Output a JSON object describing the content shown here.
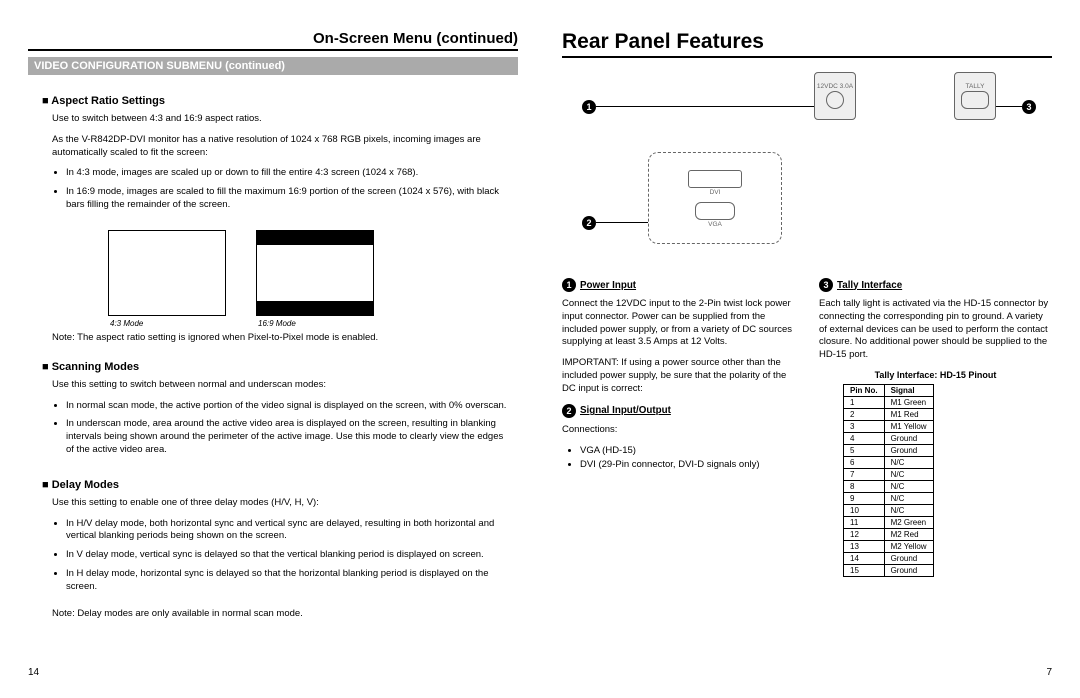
{
  "left": {
    "title": "On-Screen Menu (continued)",
    "section": "VIDEO CONFIGURATION SUBMENU (continued)",
    "s1h": "Aspect Ratio Settings",
    "s1p1": "Use to switch between 4:3 and 16:9 aspect ratios.",
    "s1p2": "As the V-R842DP-DVI monitor has a native resolution of 1024 x 768 RGB pixels, incoming images are automatically scaled to fit the screen:",
    "s1b1": "In 4:3 mode, images are scaled up or down to fill the entire 4:3 screen (1024 x 768).",
    "s1b2": "In 16:9 mode, images are scaled to fill the maximum 16:9 portion of the screen (1024 x 576), with black bars filling the remainder of the screen.",
    "cap43": "4:3 Mode",
    "cap169": "16:9 Mode",
    "s1note": "Note: The aspect ratio setting is ignored when Pixel-to-Pixel mode is enabled.",
    "s2h": "Scanning Modes",
    "s2p1": "Use this setting to switch between normal and underscan modes:",
    "s2b1": "In normal scan mode, the active portion of the video signal is displayed on the screen, with 0% overscan.",
    "s2b2": "In underscan mode, area around the active video area is displayed on the screen, resulting in blanking intervals being shown around the perimeter of the active image. Use this mode to clearly view the edges of the active video area.",
    "s3h": "Delay Modes",
    "s3p1": "Use this setting to enable one of three delay modes (H/V, H, V):",
    "s3b1": "In H/V delay mode, both horizontal sync and vertical sync are delayed, resulting in both horizontal and vertical blanking periods being shown on the screen.",
    "s3b2": "In V delay mode, vertical sync is delayed so that the vertical blanking period is displayed on screen.",
    "s3b3": "In H delay mode, horizontal sync is delayed so that the horizontal blanking period is displayed on the screen.",
    "s3note": "Note: Delay modes are only available in normal scan mode.",
    "pagenum": "14"
  },
  "right": {
    "title": "Rear Panel Features",
    "diag": {
      "l1": "12VDC 3.0A",
      "l2": "TALLY",
      "l3": "DVI",
      "l4": "VGA"
    },
    "f1h": "Power Input",
    "f1p1": "Connect the 12VDC input to the 2-Pin twist lock power input connector. Power can be supplied from the included power supply, or from a variety of DC sources supplying at least 3.5 Amps at 12 Volts.",
    "f1p2": "IMPORTANT: If using a power source other than the included power supply, be sure that the polarity of the DC input is correct:",
    "f2h": "Signal Input/Output",
    "f2p1": "Connections:",
    "f2b1": "VGA (HD-15)",
    "f2b2": "DVI (29-Pin connector, DVI-D signals only)",
    "f3h": "Tally Interface",
    "f3p1": "Each tally light is activated via the HD-15 connector by connecting the corresponding pin to ground. A variety of external devices can be used to perform the contact closure. No additional power should be supplied to the HD-15 port.",
    "pinout_title": "Tally Interface: HD-15 Pinout",
    "pin_h1": "Pin No.",
    "pin_h2": "Signal",
    "pins": [
      {
        "n": "1",
        "s": "M1 Green"
      },
      {
        "n": "2",
        "s": "M1 Red"
      },
      {
        "n": "3",
        "s": "M1 Yellow"
      },
      {
        "n": "4",
        "s": "Ground"
      },
      {
        "n": "5",
        "s": "Ground"
      },
      {
        "n": "6",
        "s": "N/C"
      },
      {
        "n": "7",
        "s": "N/C"
      },
      {
        "n": "8",
        "s": "N/C"
      },
      {
        "n": "9",
        "s": "N/C"
      },
      {
        "n": "10",
        "s": "N/C"
      },
      {
        "n": "11",
        "s": "M2 Green"
      },
      {
        "n": "12",
        "s": "M2 Red"
      },
      {
        "n": "13",
        "s": "M2 Yellow"
      },
      {
        "n": "14",
        "s": "Ground"
      },
      {
        "n": "15",
        "s": "Ground"
      }
    ],
    "pagenum": "7"
  }
}
